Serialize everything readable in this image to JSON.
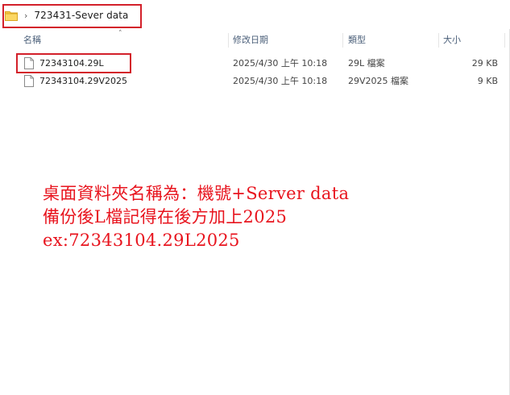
{
  "breadcrumb": {
    "folder_icon": "folder-icon",
    "separator_icon": "chevron-right-icon",
    "path": "723431-Sever data"
  },
  "columns": {
    "name": "名稱",
    "date": "修改日期",
    "type": "類型",
    "size": "大小"
  },
  "files": [
    {
      "name": "72343104.29L",
      "date": "2025/4/30 上午 10:18",
      "type": "29L 檔案",
      "size": "29 KB"
    },
    {
      "name": "72343104.29V2025",
      "date": "2025/4/30 上午 10:18",
      "type": "29V2025 檔案",
      "size": "9 KB"
    }
  ],
  "annotation": {
    "line1": "桌面資料夾名稱為：機號+Server data",
    "line2": "備份後L檔記得在後方加上2025",
    "line3": "ex:72343104.29L2025",
    "color": "#e8141e"
  },
  "colors": {
    "highlight_box": "#d3202a",
    "header_text": "#4c607a",
    "folder_yellow": "#f7c948"
  }
}
